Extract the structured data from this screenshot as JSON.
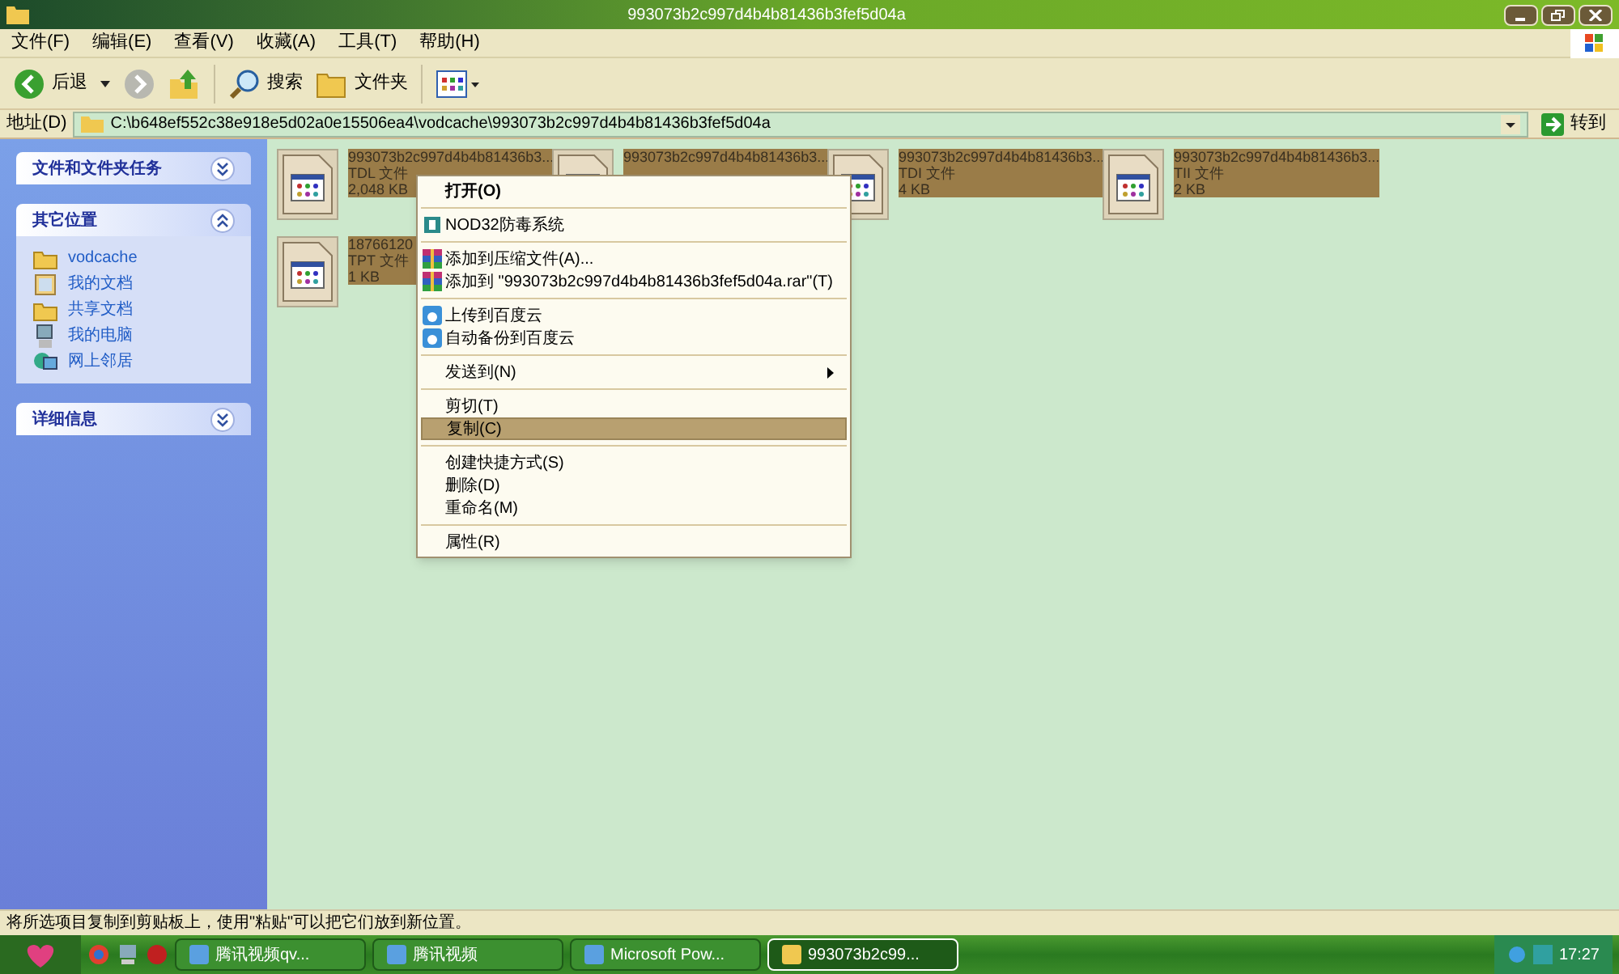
{
  "window": {
    "title": "993073b2c997d4b4b81436b3fef5d04a"
  },
  "menu": [
    {
      "label": "文件(F)"
    },
    {
      "label": "编辑(E)"
    },
    {
      "label": "查看(V)"
    },
    {
      "label": "收藏(A)"
    },
    {
      "label": "工具(T)"
    },
    {
      "label": "帮助(H)"
    }
  ],
  "toolbar": {
    "back": "后退",
    "search": "搜索",
    "folders": "文件夹"
  },
  "address": {
    "label": "地址(D)",
    "value": "C:\\b648ef552c38e918e5d02a0e15506ea4\\vodcache\\993073b2c997d4b4b81436b3fef5d04a",
    "go": "转到"
  },
  "sidebar": [
    {
      "title": "文件和文件夹任务",
      "expanded": false
    },
    {
      "title": "其它位置",
      "expanded": true,
      "items": [
        {
          "label": "vodcache",
          "kind": "folder"
        },
        {
          "label": "我的文档",
          "kind": "documents"
        },
        {
          "label": "共享文档",
          "kind": "folder"
        },
        {
          "label": "我的电脑",
          "kind": "computer"
        },
        {
          "label": "网上邻居",
          "kind": "network"
        }
      ]
    },
    {
      "title": "详细信息",
      "expanded": false
    }
  ],
  "files": [
    {
      "name": "993073b2c997d4b4b81436b3...",
      "type": "TDL 文件",
      "size": "2,048 KB",
      "selected": true
    },
    {
      "name": "993073b2c997d4b4b81436b3...",
      "selected": true
    },
    {
      "name": "993073b2c997d4b4b81436b3...",
      "type": "TDI 文件",
      "size": "4 KB",
      "selected": true
    },
    {
      "name": "993073b2c997d4b4b81436b3...",
      "type": "TII 文件",
      "size": "2 KB",
      "selected": true
    },
    {
      "name": "18766120",
      "type": "TPT 文件",
      "size": "1 KB",
      "selected": true
    }
  ],
  "context_menu": [
    {
      "kind": "plain",
      "label": "打开(O)",
      "bold": true
    },
    {
      "kind": "separator"
    },
    {
      "kind": "shield",
      "label": "NOD32防毒系统"
    },
    {
      "kind": "separator"
    },
    {
      "kind": "archive",
      "label": "添加到压缩文件(A)..."
    },
    {
      "kind": "archive",
      "label": "添加到 \"993073b2c997d4b4b81436b3fef5d04a.rar\"(T)"
    },
    {
      "kind": "separator"
    },
    {
      "kind": "cloud",
      "label": "上传到百度云"
    },
    {
      "kind": "cloud",
      "label": "自动备份到百度云"
    },
    {
      "kind": "separator"
    },
    {
      "kind": "plain",
      "label": "发送到(N)",
      "submenu": true
    },
    {
      "kind": "separator"
    },
    {
      "kind": "plain",
      "label": "剪切(T)",
      "selected": false
    },
    {
      "kind": "plain",
      "label": "复制(C)",
      "selected": true
    },
    {
      "kind": "separator"
    },
    {
      "kind": "plain",
      "label": "创建快捷方式(S)"
    },
    {
      "kind": "plain",
      "label": "删除(D)"
    },
    {
      "kind": "plain",
      "label": "重命名(M)"
    },
    {
      "kind": "separator"
    },
    {
      "kind": "plain",
      "label": "属性(R)"
    }
  ],
  "status_bar": "将所选项目复制到剪贴板上，使用\"粘贴\"可以把它们放到新位置。",
  "taskbar": {
    "tasks": [
      {
        "label": "腾讯视频qv...",
        "selected": false
      },
      {
        "label": "腾讯视频",
        "selected": false
      },
      {
        "label": "Microsoft Pow...",
        "selected": false
      },
      {
        "label": "993073b2c99...",
        "selected": true
      }
    ],
    "clock": "17:27"
  }
}
